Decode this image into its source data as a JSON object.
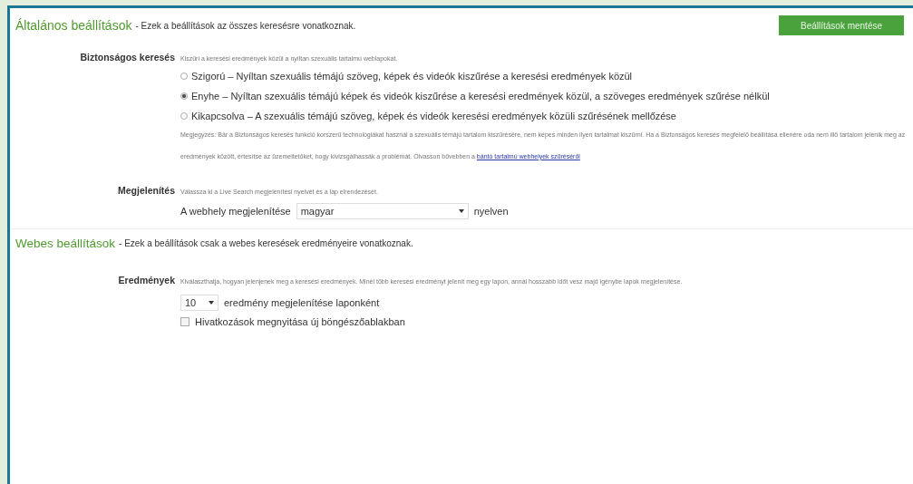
{
  "general": {
    "title": "Általános beállítások",
    "subtitle": "- Ezek a beállítások az összes keresésre vonatkoznak.",
    "save_button": "Beállítások mentése"
  },
  "safe_search": {
    "label": "Biztonságos keresés",
    "description": "Kiszűri a keresési eredmények közül a nyíltan szexuális tartalmú weblapokat.",
    "options": [
      {
        "label": "Szigorú – Nyíltan szexuális témájú szöveg, képek és videók kiszűrése a keresési eredmények közül",
        "selected": false
      },
      {
        "label": "Enyhe – Nyíltan szexuális témájú képek és videók kiszűrése a keresési eredmények közül, a szöveges eredmények szűrése nélkül",
        "selected": true
      },
      {
        "label": "Kikapcsolva – A szexuális témájú szöveg, képek és videók keresési eredmények közüli szűrésének mellőzése",
        "selected": false
      }
    ],
    "note": "Megjegyzés: Bár a Biztonságos keresés funkció korszerű technológiákat használ a szexuális témájú tartalom kiszűrésére, nem képes minden ilyen tartalmat kiszűrni. Ha a Biztonságos keresés megfelelő beállítása ellenére oda nem illő tartalom jelenik meg az eredmények között, értesítse az üzemeltetőket, hogy kivizsgálhassák a problémát. Olvasson bővebben a",
    "note_link": "bántó tartalmú webhelyek szűréséről"
  },
  "display": {
    "label": "Megjelenítés",
    "description": "Válassza ki a Live Search megjelenítési nyelvét és a lap elrendezését.",
    "prefix": "A webhely megjelenítése",
    "language": "magyar",
    "suffix": "nyelven"
  },
  "web": {
    "title": "Webes beállítások",
    "subtitle": "- Ezek a beállítások csak a webes keresések eredményeire vonatkoznak."
  },
  "results": {
    "label": "Eredmények",
    "description": "Kiválaszthatja, hogyan jelenjenek meg a keresési eredmények. Minél több keresési eredményt jelenít meg egy lapon, annál hosszabb időt vesz majd igénybe lapok megjelenítése.",
    "count": "10",
    "count_suffix": "eredmény megjelenítése laponként",
    "new_window": {
      "label": "Hivatkozások megnyitása új böngészőablakban",
      "checked": false
    }
  }
}
